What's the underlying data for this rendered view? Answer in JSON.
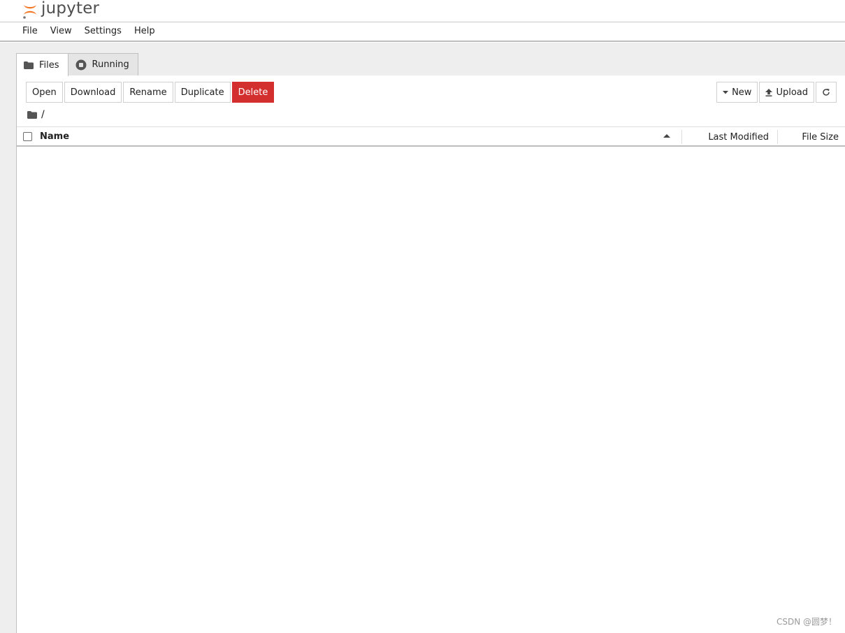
{
  "header": {
    "logo_text": "jupyter"
  },
  "menu": [
    "File",
    "View",
    "Settings",
    "Help"
  ],
  "tabs": [
    {
      "label": "Files",
      "icon": "folder-icon",
      "active": true
    },
    {
      "label": "Running",
      "icon": "stop-circle-icon",
      "active": false
    }
  ],
  "toolbar": {
    "open": "Open",
    "download": "Download",
    "rename": "Rename",
    "duplicate": "Duplicate",
    "delete": "Delete",
    "new": "New",
    "upload": "Upload",
    "delete_color": "#d32f2f"
  },
  "breadcrumb": {
    "path": "/"
  },
  "columns": {
    "name": "Name",
    "last_modified": "Last Modified",
    "file_size": "File Size"
  },
  "files": [],
  "watermark": "CSDN @圆梦！"
}
